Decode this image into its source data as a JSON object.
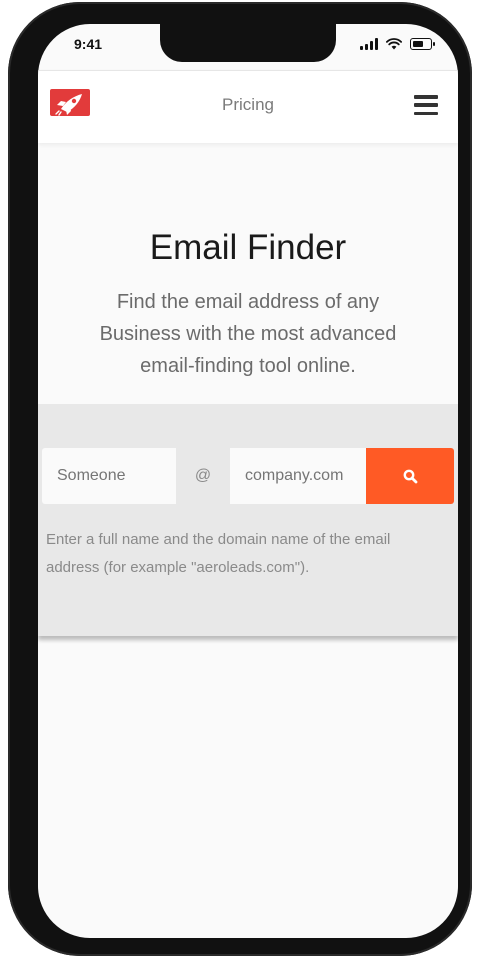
{
  "status_bar": {
    "time": "9:41",
    "icons": [
      "cellular-signal-icon",
      "wifi-icon",
      "battery-icon"
    ]
  },
  "nav": {
    "logo": "rocket-logo",
    "link_label": "Pricing",
    "menu_icon": "hamburger-menu-icon"
  },
  "hero": {
    "title": "Email Finder",
    "subtitle": "Find the email address of any Business with the most advanced email-finding tool online."
  },
  "search": {
    "name_placeholder": "Someone",
    "at_symbol": "@",
    "domain_placeholder": "company.com",
    "button_icon": "search-icon",
    "helper_text": "Enter a full name and the domain name of the email address (for example \"aeroleads.com\")."
  },
  "colors": {
    "accent": "#ff5a25",
    "logo": "#e23b3b",
    "search_section_bg": "#e8e8e8"
  }
}
